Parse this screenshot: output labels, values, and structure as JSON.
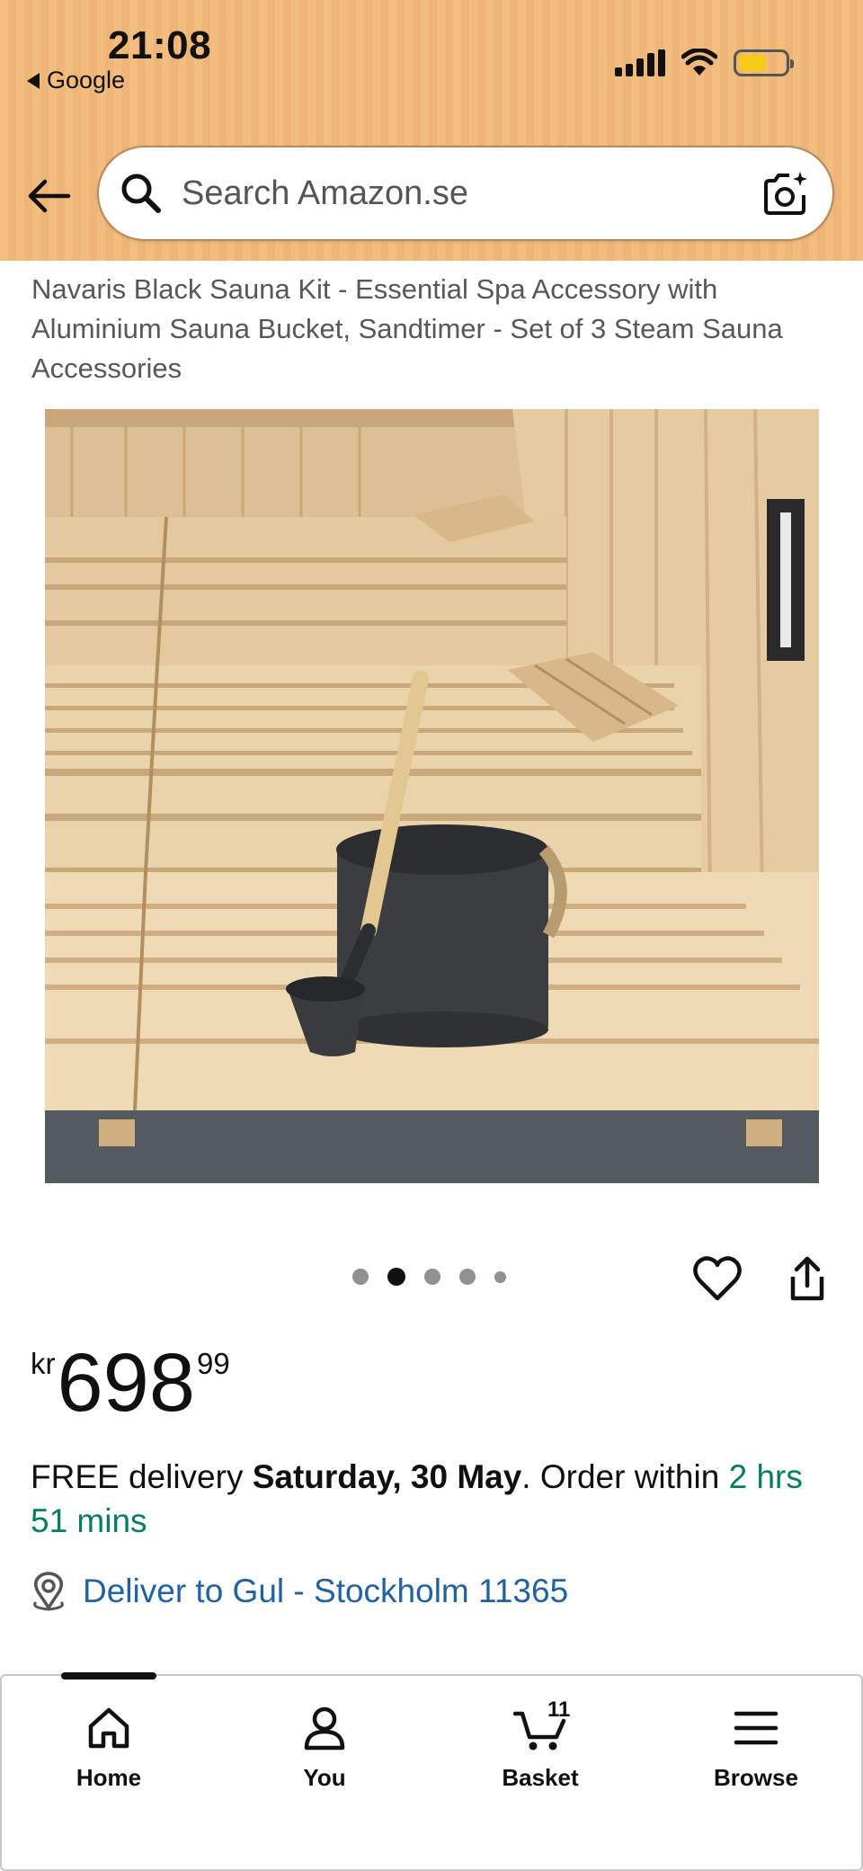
{
  "status_bar": {
    "time": "21:08",
    "back_app": "Google",
    "icons": [
      "cellular-signal-icon",
      "wifi-icon",
      "battery-icon"
    ],
    "battery_level": 0.6
  },
  "search": {
    "placeholder": "Search Amazon.se"
  },
  "product": {
    "title": "Navaris Black Sauna Kit - Essential Spa Accessory with Aluminium Sauna Bucket, Sandtimer - Set of 3 Steam Sauna Accessories",
    "image_alt": "Navaris Black Sauna Kit in a sauna",
    "image_count": 5,
    "active_image_index": 1
  },
  "price": {
    "currency": "kr",
    "whole": "698",
    "fraction": "99"
  },
  "delivery": {
    "prefix": "FREE delivery ",
    "date": "Saturday, 30 May",
    "middle": ". Order within ",
    "countdown": "2 hrs 51 mins",
    "deliver_to": "Deliver to Gul - Stockholm 11365"
  },
  "tabbar": {
    "tabs": [
      {
        "label": "Home",
        "icon": "home-icon"
      },
      {
        "label": "You",
        "icon": "person-icon"
      },
      {
        "label": "Basket",
        "icon": "cart-icon",
        "badge": "11"
      },
      {
        "label": "Browse",
        "icon": "menu-icon"
      }
    ],
    "active_index": 0
  },
  "colors": {
    "header_bg": "#f4bd80",
    "link_blue": "#2162a1",
    "countdown_green": "#067d62"
  }
}
